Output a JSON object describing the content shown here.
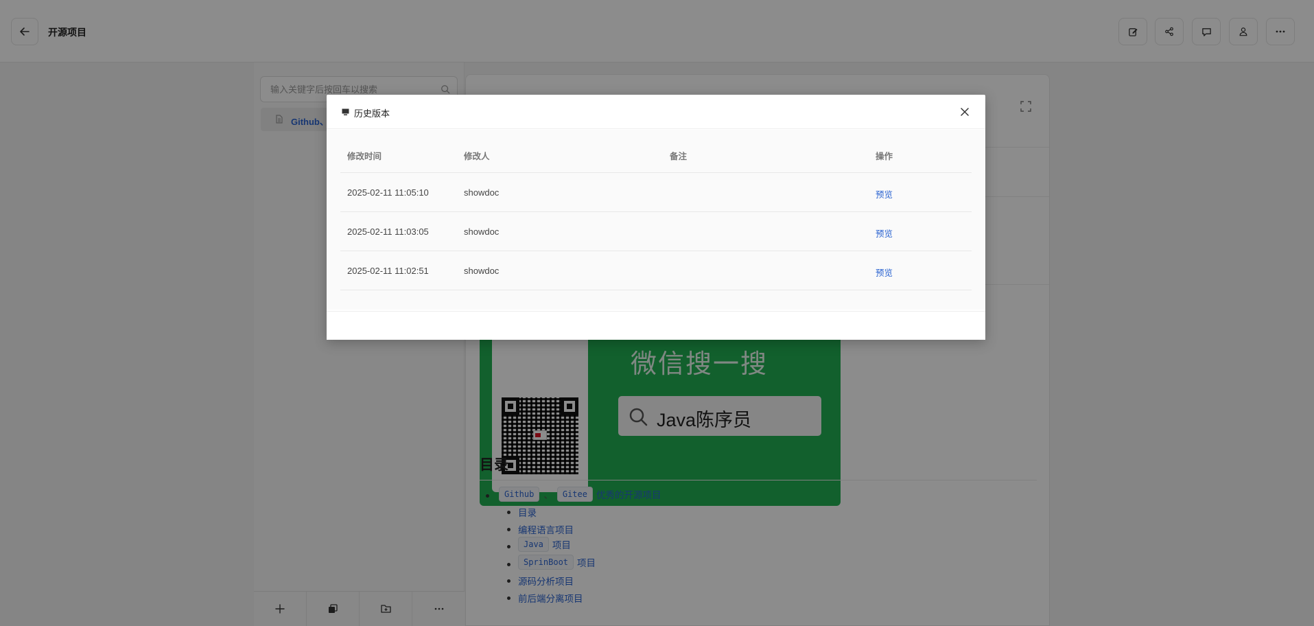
{
  "header": {
    "title": "开源项目"
  },
  "sidebar": {
    "search_placeholder": "输入关键字后按回车以搜索",
    "tree_item_label": "Github、"
  },
  "content": {
    "banner_heading": "微信搜一搜",
    "banner_search_text": "Java陈序员",
    "toc_title": "目录",
    "toc_items": [
      {
        "tag1": "Github",
        "sep": "、",
        "tag2": "Gitee",
        "text": "优秀的开源项目"
      },
      {
        "text": "目录"
      },
      {
        "text": "编程语言项目"
      },
      {
        "tag1": "Java",
        "text": "项目"
      },
      {
        "tag1": "SprinBoot",
        "text": "项目"
      },
      {
        "text": "源码分析项目"
      },
      {
        "text": "前后端分离项目"
      }
    ]
  },
  "dialog": {
    "title": "历史版本",
    "columns": [
      "修改时间",
      "修改人",
      "备注",
      "操作"
    ],
    "rows": [
      {
        "time": "2025-02-11 11:05:10",
        "user": "showdoc",
        "note": "",
        "action": "预览"
      },
      {
        "time": "2025-02-11 11:03:05",
        "user": "showdoc",
        "note": "",
        "action": "预览"
      },
      {
        "time": "2025-02-11 11:02:51",
        "user": "showdoc",
        "note": "",
        "action": "预览"
      }
    ]
  },
  "colors": {
    "link": "#2a63d0",
    "banner_green": "#22b052",
    "overlay": "rgba(0,0,0,0.45)"
  },
  "icons": {
    "back": "arrow-left-icon",
    "header_actions": [
      "edit-icon",
      "share-icon",
      "comment-icon",
      "user-icon",
      "more-icon"
    ],
    "sidebar_footer": [
      "plus-icon",
      "copy-icon",
      "folder-add-icon",
      "more-icon"
    ],
    "dialog_title": "monitor-icon",
    "dialog_close": "close-icon"
  }
}
